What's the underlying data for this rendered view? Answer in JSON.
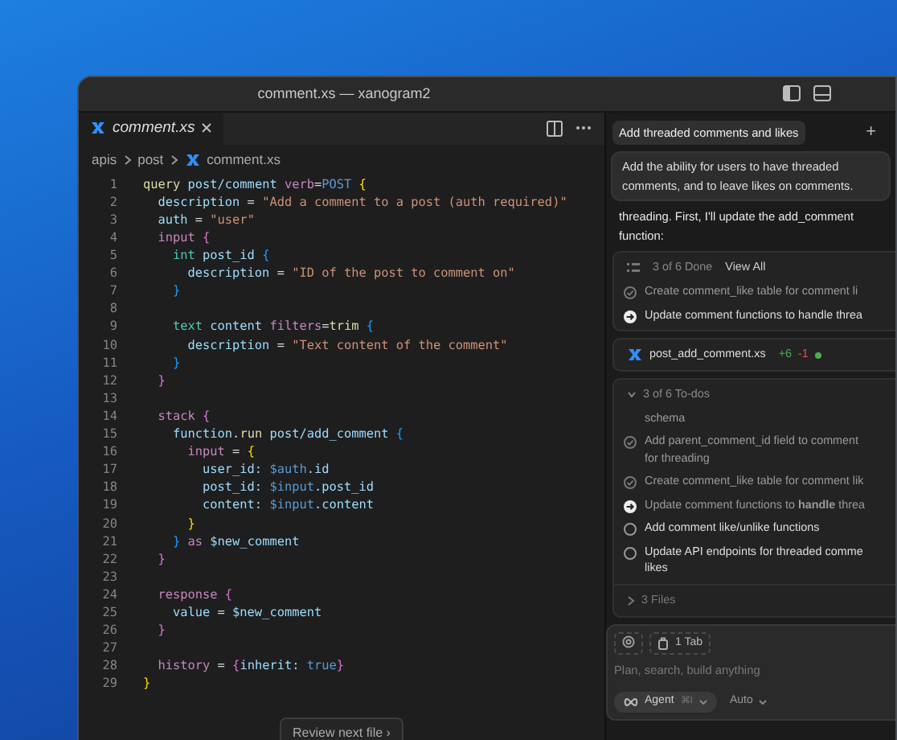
{
  "window": {
    "title": "comment.xs — xanogram2"
  },
  "editor": {
    "tab": {
      "label": "comment.xs",
      "selected": true
    },
    "breadcrumbs": [
      "apis",
      "post",
      "comment.xs"
    ],
    "lines": [
      {
        "number": "1",
        "tokens": [
          {
            "text": "query",
            "kind": "fn"
          },
          {
            "text": " post/comment ",
            "kind": "id"
          },
          {
            "text": "verb",
            "kind": "kw"
          },
          {
            "text": "=",
            "kind": "op"
          },
          {
            "text": "POST",
            "kind": "const"
          },
          {
            "text": " {",
            "kind": "b1"
          }
        ]
      },
      {
        "number": "2",
        "tokens": [
          {
            "text": "  description",
            "kind": "id"
          },
          {
            "text": " = ",
            "kind": "op"
          },
          {
            "text": "\"Add a comment to a post (auth required)\"",
            "kind": "str"
          }
        ]
      },
      {
        "number": "3",
        "tokens": [
          {
            "text": "  auth",
            "kind": "id"
          },
          {
            "text": " = ",
            "kind": "op"
          },
          {
            "text": "\"user\"",
            "kind": "str"
          }
        ]
      },
      {
        "number": "4",
        "tokens": [
          {
            "text": "  input",
            "kind": "kw"
          },
          {
            "text": " {",
            "kind": "b2"
          }
        ]
      },
      {
        "number": "5",
        "tokens": [
          {
            "text": "    int",
            "kind": "type"
          },
          {
            "text": " post_id",
            "kind": "id"
          },
          {
            "text": " {",
            "kind": "b3"
          }
        ]
      },
      {
        "number": "6",
        "tokens": [
          {
            "text": "      description",
            "kind": "id"
          },
          {
            "text": " = ",
            "kind": "op"
          },
          {
            "text": "\"ID of the post to comment on\"",
            "kind": "str"
          }
        ]
      },
      {
        "number": "7",
        "tokens": [
          {
            "text": "    }",
            "kind": "b3"
          }
        ]
      },
      {
        "number": "8"
      },
      {
        "number": "9",
        "tokens": [
          {
            "text": "    text",
            "kind": "type"
          },
          {
            "text": " content ",
            "kind": "id"
          },
          {
            "text": "filters",
            "kind": "kw"
          },
          {
            "text": "=",
            "kind": "op"
          },
          {
            "text": "trim",
            "kind": "fn"
          },
          {
            "text": " {",
            "kind": "b3"
          }
        ]
      },
      {
        "number": "10",
        "tokens": [
          {
            "text": "      description",
            "kind": "id"
          },
          {
            "text": " = ",
            "kind": "op"
          },
          {
            "text": "\"Text content of the comment\"",
            "kind": "str"
          }
        ]
      },
      {
        "number": "11",
        "tokens": [
          {
            "text": "    }",
            "kind": "b3"
          }
        ]
      },
      {
        "number": "12",
        "tokens": [
          {
            "text": "  }",
            "kind": "b2"
          }
        ]
      },
      {
        "number": "13"
      },
      {
        "number": "14",
        "tokens": [
          {
            "text": "  stack",
            "kind": "kw"
          },
          {
            "text": " {",
            "kind": "b2"
          }
        ]
      },
      {
        "number": "15",
        "tokens": [
          {
            "text": "    function",
            "kind": "id"
          },
          {
            "text": ".",
            "kind": "op"
          },
          {
            "text": "run",
            "kind": "fn"
          },
          {
            "text": " post/add_comment",
            "kind": "id"
          },
          {
            "text": " {",
            "kind": "b3"
          }
        ]
      },
      {
        "number": "16",
        "tokens": [
          {
            "text": "      input",
            "kind": "kw"
          },
          {
            "text": " = ",
            "kind": "op"
          },
          {
            "text": "{",
            "kind": "b1"
          }
        ]
      },
      {
        "number": "17",
        "tokens": [
          {
            "text": "        user_id: ",
            "kind": "id"
          },
          {
            "text": "$auth",
            "kind": "const"
          },
          {
            "text": ".id",
            "kind": "id"
          }
        ]
      },
      {
        "number": "18",
        "tokens": [
          {
            "text": "        post_id: ",
            "kind": "id"
          },
          {
            "text": "$input",
            "kind": "const"
          },
          {
            "text": ".post_id",
            "kind": "id"
          }
        ]
      },
      {
        "number": "19",
        "tokens": [
          {
            "text": "        content: ",
            "kind": "id"
          },
          {
            "text": "$input",
            "kind": "const"
          },
          {
            "text": ".content",
            "kind": "id"
          }
        ]
      },
      {
        "number": "20",
        "tokens": [
          {
            "text": "      }",
            "kind": "b1"
          }
        ]
      },
      {
        "number": "21",
        "tokens": [
          {
            "text": "    }",
            "kind": "b3"
          },
          {
            "text": " as ",
            "kind": "kw"
          },
          {
            "text": "$new_comment",
            "kind": "id"
          }
        ]
      },
      {
        "number": "22",
        "tokens": [
          {
            "text": "  }",
            "kind": "b2"
          }
        ]
      },
      {
        "number": "23"
      },
      {
        "number": "24",
        "tokens": [
          {
            "text": "  response",
            "kind": "kw"
          },
          {
            "text": " {",
            "kind": "b2"
          }
        ]
      },
      {
        "number": "25",
        "tokens": [
          {
            "text": "    value",
            "kind": "id"
          },
          {
            "text": " = ",
            "kind": "op"
          },
          {
            "text": "$new_comment",
            "kind": "id"
          }
        ]
      },
      {
        "number": "26",
        "tokens": [
          {
            "text": "  }",
            "kind": "b2"
          }
        ]
      },
      {
        "number": "27"
      },
      {
        "number": "28",
        "tokens": [
          {
            "text": "  history",
            "kind": "kw"
          },
          {
            "text": " = ",
            "kind": "op"
          },
          {
            "text": "{",
            "kind": "b2"
          },
          {
            "text": "inherit: ",
            "kind": "id"
          },
          {
            "text": "true",
            "kind": "const"
          },
          {
            "text": "}",
            "kind": "b2"
          }
        ]
      },
      {
        "number": "29",
        "tokens": [
          {
            "text": "}",
            "kind": "b1"
          }
        ]
      }
    ],
    "review_button": {
      "label": "Review next file",
      "chevron": "›"
    }
  },
  "chat": {
    "title": "Add threaded comments and likes",
    "new_chat": "+",
    "user_message": "Add the ability for users to have threaded comments, and to leave likes on comments.",
    "reply_lines": [
      "threading. First, I'll update the add_comment",
      "function:"
    ],
    "progress": {
      "summary": "3 of 6 Done",
      "link": "View All",
      "items": [
        {
          "lines": [
            "Create comment_like table for comment li"
          ],
          "checked": true,
          "current": false
        },
        {
          "lines": [
            "Update comment functions to handle threa"
          ],
          "checked": false,
          "current": true
        }
      ]
    },
    "file_chip": {
      "name": "post_add_comment.xs",
      "added": "+6",
      "removed": "-1"
    },
    "todos": {
      "summary": "3 of 6 To-dos",
      "expanded": true,
      "scrolled_line": "schema",
      "items": [
        {
          "lines": [
            "Add parent_comment_id field to comment",
            "for threading"
          ],
          "checked": true,
          "current": false
        },
        {
          "lines": [
            "Create comment_like table for comment lik"
          ],
          "checked": true,
          "current": false
        },
        {
          "lines": [
            "Update comment functions to **handle** threa"
          ],
          "checked": false,
          "current": true
        },
        {
          "lines": [
            "Add comment like/unlike functions"
          ],
          "checked": false,
          "current": false
        },
        {
          "lines": [
            "Update API endpoints for threaded comme",
            "likes"
          ],
          "checked": false,
          "current": false
        }
      ]
    },
    "files": {
      "label": "3 Files",
      "expanded": false
    },
    "composer": {
      "context": "1 Tab",
      "placeholder": "Plan, search, build anything",
      "mode": "Agent",
      "shortcut": "⌘I",
      "model": "Auto"
    }
  }
}
